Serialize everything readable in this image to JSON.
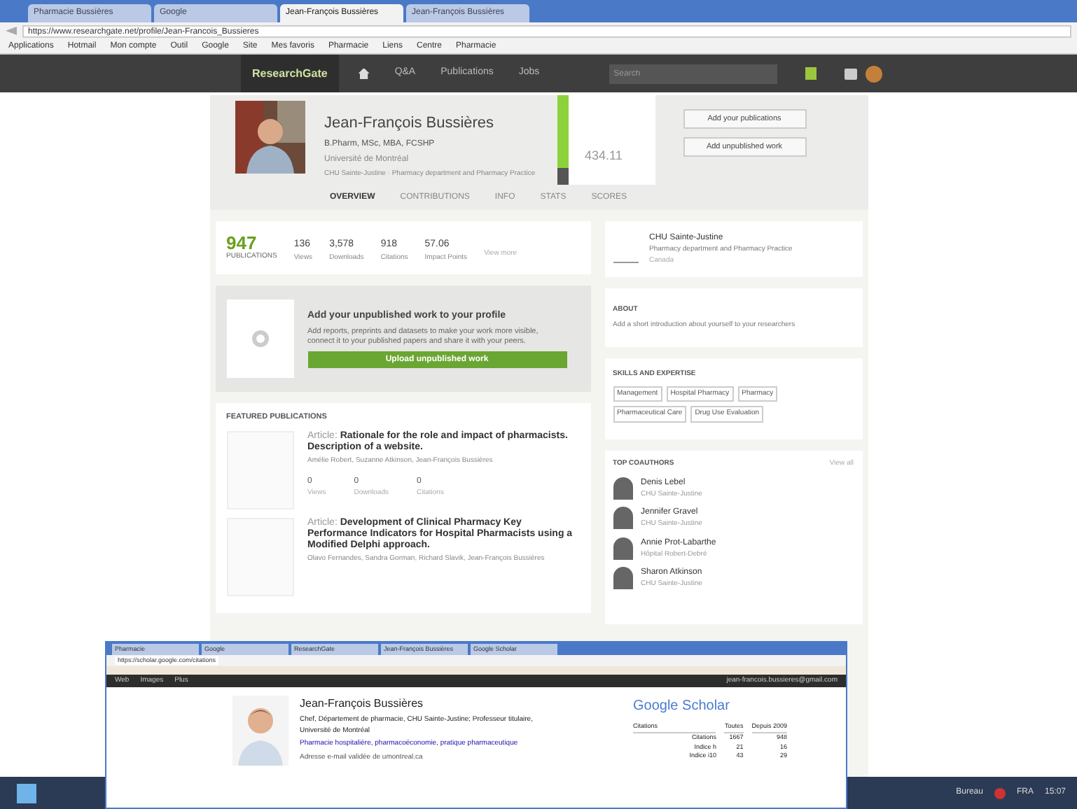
{
  "browser": {
    "tabs": [
      {
        "title": "Pharmacie Bussières",
        "selected": false
      },
      {
        "title": "Google",
        "selected": false
      },
      {
        "title": "Jean-François Bussières",
        "selected": true
      },
      {
        "title": "Jean-François Bussières",
        "selected": false
      }
    ],
    "address": "https://www.researchgate.net/profile/Jean-Francois_Bussieres",
    "bookmarks": [
      "Applications",
      "Hotmail",
      "Mon compte",
      "Outil",
      "Google",
      "Site",
      "Mes favoris",
      "Pharmacie",
      "Liens",
      "Centre",
      "Pharmacie"
    ]
  },
  "nav": {
    "logo": "ResearchGate",
    "items": [
      "Q&A",
      "Publications",
      "Jobs"
    ],
    "search_placeholder": "Search"
  },
  "profile": {
    "name": "Jean-François Bussières",
    "degrees": "B.Pharm, MSc, MBA, FCSHP",
    "position": "Université de Montréal",
    "affiliation": "CHU Sainte-Justine · Pharmacy department and Pharmacy Practice",
    "score": "434.11",
    "level": 0.82,
    "buttons": [
      "Add your publications",
      "Add unpublished work"
    ],
    "tabs": [
      {
        "label": "OVERVIEW",
        "selected": true
      },
      {
        "label": "CONTRIBUTIONS",
        "selected": false
      },
      {
        "label": "INFO",
        "selected": false
      },
      {
        "label": "STATS",
        "selected": false
      },
      {
        "label": "SCORES",
        "selected": false
      }
    ]
  },
  "stats": {
    "main": {
      "value": "947",
      "label": "PUBLICATIONS"
    },
    "items": [
      {
        "value": "136",
        "label": "Views"
      },
      {
        "value": "3,578",
        "label": "Downloads"
      },
      {
        "value": "918",
        "label": "Citations"
      },
      {
        "value": "57.06",
        "label": "Impact Points"
      }
    ],
    "link": "View more"
  },
  "unpublished": {
    "title": "Add your unpublished work to your profile",
    "text": "Add reports, preprints and datasets to make your work more visible, connect it to your published papers and share it with your peers.",
    "button": "Upload unpublished work"
  },
  "featured": {
    "title": "FEATURED PUBLICATIONS",
    "items": [
      {
        "type": "Article:",
        "title": "Rationale for the role and impact of pharmacists. Description of a website.",
        "authors": "Amélie Robert, Suzanne Atkinson, Jean-François Bussières",
        "stats": [
          {
            "value": "0",
            "label": "Views"
          },
          {
            "value": "0",
            "label": "Downloads"
          },
          {
            "value": "0",
            "label": "Citations"
          }
        ]
      },
      {
        "type": "Article:",
        "title": "Development of Clinical Pharmacy Key Performance Indicators for Hospital Pharmacists using a Modified Delphi approach.",
        "authors": "Olavo Fernandes, Sandra Gorman, Richard Slavik, Jean-François Bussières"
      }
    ]
  },
  "institution": {
    "name": "CHU Sainte-Justine",
    "department": "Pharmacy department and Pharmacy Practice",
    "location": "Canada"
  },
  "about": {
    "title": "ABOUT",
    "text": "Add a short introduction about yourself to your researchers"
  },
  "skills": {
    "title": "SKILLS AND EXPERTISE",
    "tags": [
      "Management",
      "Hospital Pharmacy",
      "Pharmacy",
      "Pharmaceutical Care",
      "Drug Use Evaluation"
    ]
  },
  "coauthors": {
    "title": "TOP COAUTHORS",
    "link": "View all",
    "items": [
      {
        "name": "Denis Lebel",
        "meta": "CHU Sainte-Justine"
      },
      {
        "name": "Jennifer Gravel",
        "meta": "CHU Sainte-Justine"
      },
      {
        "name": "Annie Prot-Labarthe",
        "meta": "Hôpital Robert-Debré"
      },
      {
        "name": "Sharon Atkinson",
        "meta": "CHU Sainte-Justine"
      }
    ]
  },
  "scholar": {
    "tabs": [
      "Pharmacie",
      "Google",
      "ResearchGate",
      "Jean-François Bussières",
      "Google Scholar"
    ],
    "address": "https://scholar.google.com/citations",
    "bar": [
      "Web",
      "Images",
      "Plus"
    ],
    "account": "jean-francois.bussieres@gmail.com",
    "name": "Jean-François Bussières",
    "line1": "Chef, Département de pharmacie, CHU Sainte-Justine; Professeur titulaire, Université de Montréal",
    "line2": "Pharmacie hospitalière, pharmacoéconomie, pratique pharmaceutique",
    "line3": "Adresse e-mail validée de umontreal.ca",
    "logo": "Google Scholar",
    "columns": [
      "Citations",
      "Toutes",
      "Depuis 2009"
    ],
    "rows": [
      [
        "Citations",
        "1667",
        "948"
      ],
      [
        "Indice h",
        "21",
        "16"
      ],
      [
        "Indice i10",
        "43",
        "29"
      ]
    ]
  },
  "taskbar": {
    "tray": "Bureau",
    "lang": "FRA",
    "time": "15:07"
  }
}
